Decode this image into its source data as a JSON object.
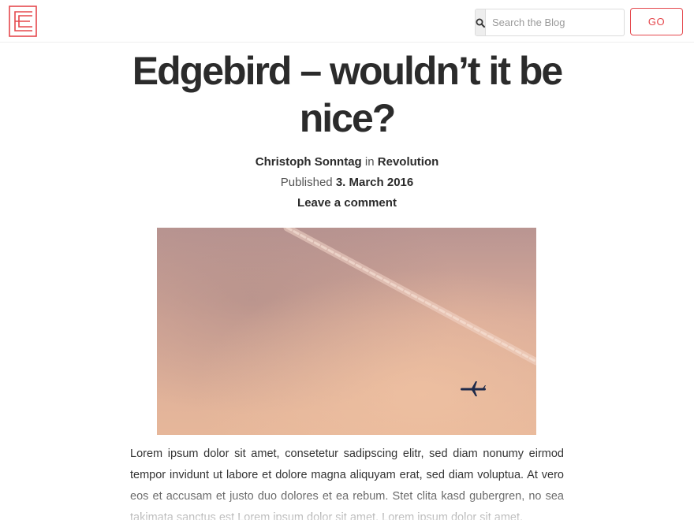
{
  "header": {
    "logo_icon": "edgebird-logo-icon",
    "search": {
      "placeholder": "Search the Blog",
      "value": "",
      "icon": "search-icon"
    },
    "go_label": "GO",
    "accent_color": "#e5484d"
  },
  "post": {
    "title": "Edgebird – wouldn’t it be nice?",
    "author": "Christoph Sonntag",
    "in_word": "in",
    "category": "Revolution",
    "published_label": "Published",
    "date": "3. March 2016",
    "comment_link": "Leave a comment",
    "hero_image": "airplane-in-pink-sky-photo",
    "body": "Lorem ipsum dolor sit amet, consetetur sadipscing elitr, sed diam nonumy eirmod tempor invidunt ut labore et dolore magna aliquyam erat, sed diam voluptua. At vero eos et accusam et justo duo dolores et ea rebum. Stet clita kasd gubergren, no sea takimata sanctus est Lorem ipsum dolor sit amet. Lorem ipsum dolor sit amet,"
  }
}
